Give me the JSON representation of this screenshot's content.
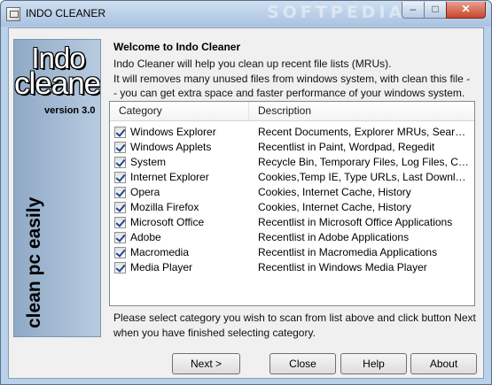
{
  "window": {
    "title": "INDO CLEANER",
    "watermark": "SOFTPEDIA",
    "controls": {
      "minimize": "–",
      "maximize": "□",
      "close": "✕"
    }
  },
  "sidebar": {
    "logo_line1": "Indo",
    "logo_line2": "cleaner",
    "version": "version 3.0",
    "slogan": "clean pc easily"
  },
  "welcome": {
    "title": "Welcome to Indo Cleaner",
    "lines": [
      "Indo Cleaner will help you clean up recent file lists (MRUs).",
      "It will removes many unused files from windows system, with clean this file -",
      "- you can get extra space and faster performance of your windows system."
    ]
  },
  "list": {
    "columns": [
      "Category",
      "Description"
    ],
    "rows": [
      {
        "category": "Windows Explorer",
        "description": "Recent Documents, Explorer MRUs, Search Auto",
        "checked": true
      },
      {
        "category": "Windows Applets",
        "description": "Recentlist in Paint, Wordpad, Regedit",
        "checked": true
      },
      {
        "category": "System",
        "description": "Recycle Bin, Temporary Files, Log Files, Clipboard",
        "checked": true
      },
      {
        "category": "Internet Explorer",
        "description": "Cookies,Temp IE, Type URLs, Last Download",
        "checked": true
      },
      {
        "category": "Opera",
        "description": "Cookies, Internet Cache, History",
        "checked": true
      },
      {
        "category": "Mozilla Firefox",
        "description": "Cookies, Internet Cache, History",
        "checked": true
      },
      {
        "category": "Microsoft Office",
        "description": "Recentlist in Microsoft Office Applications",
        "checked": true
      },
      {
        "category": "Adobe",
        "description": "Recentlist in Adobe Applications",
        "checked": true
      },
      {
        "category": "Macromedia",
        "description": "Recentlist in Macromedia Applications",
        "checked": true
      },
      {
        "category": "Media Player",
        "description": "Recentlist in Windows Media Player",
        "checked": true
      }
    ]
  },
  "instructions": [
    "Please select category you wish to scan from list above and click button Next",
    "when you have finished selecting category."
  ],
  "buttons": {
    "next": "Next >",
    "close": "Close",
    "help": "Help",
    "about": "About"
  }
}
